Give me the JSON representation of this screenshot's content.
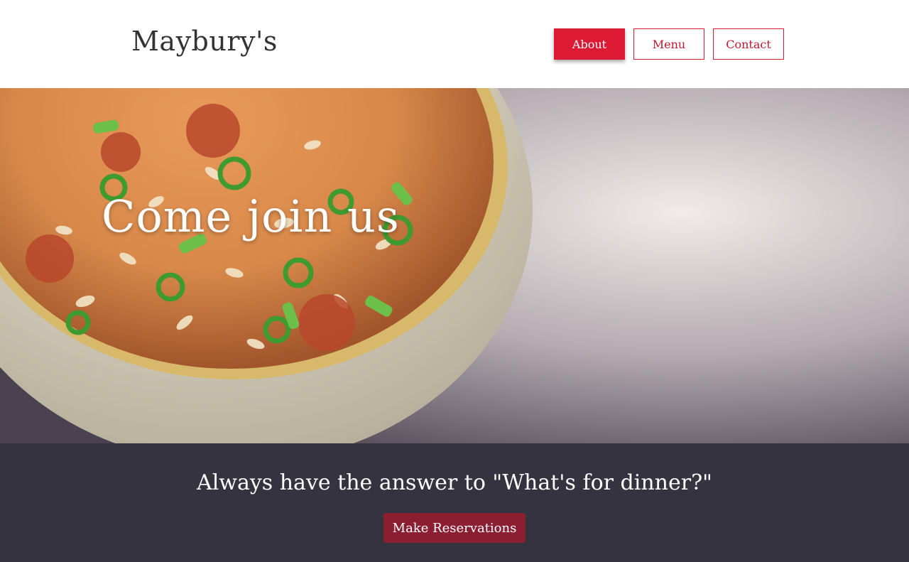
{
  "header": {
    "brand": "Maybury's",
    "nav": [
      {
        "label": "About",
        "active": true
      },
      {
        "label": "Menu",
        "active": false
      },
      {
        "label": "Contact",
        "active": false
      }
    ]
  },
  "hero": {
    "title": "Come join us",
    "image": "bowl of jambalaya with green onions"
  },
  "cta": {
    "text": "Always have the answer to \"What's for dinner?\"",
    "button_label": "Make Reservations"
  },
  "colors": {
    "accent": "#dc1a33",
    "cta_background": "#363340",
    "cta_button": "#8c1e32"
  }
}
